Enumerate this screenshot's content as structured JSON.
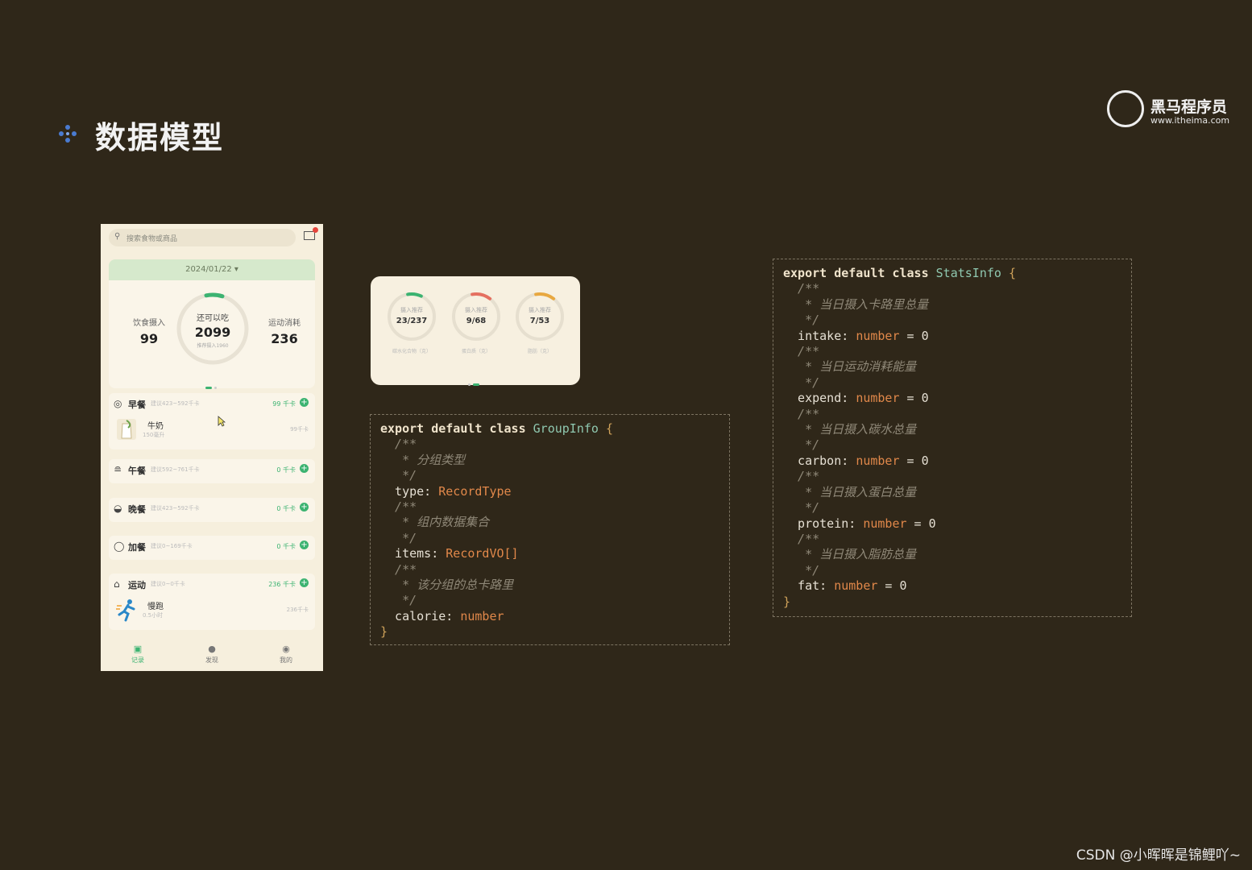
{
  "slide": {
    "title": "数据模型",
    "logo_text": "黑马程序员",
    "logo_url": "www.itheima.com",
    "watermark": "CSDN @小晖晖是锦鲤吖~"
  },
  "phone": {
    "search_placeholder": "搜索食物或商品",
    "date": "2024/01/22 ▾",
    "summary": {
      "intake_label": "饮食摄入",
      "intake_value": "99",
      "remain_label": "还可以吃",
      "remain_value": "2099",
      "recommend_label": "推荐摄入1960",
      "expend_label": "运动消耗",
      "expend_value": "236"
    },
    "meals": [
      {
        "name": "早餐",
        "suggest": "建议423~592千卡",
        "kcal": "99 千卡",
        "item_name": "牛奶",
        "item_amount": "150毫升",
        "item_kcal": "99千卡"
      },
      {
        "name": "午餐",
        "suggest": "建议592~761千卡",
        "kcal": "0 千卡"
      },
      {
        "name": "晚餐",
        "suggest": "建议423~592千卡",
        "kcal": "0 千卡"
      },
      {
        "name": "加餐",
        "suggest": "建议0~169千卡",
        "kcal": "0 千卡"
      },
      {
        "name": "运动",
        "suggest": "建议0~0千卡",
        "kcal": "236 千卡",
        "item_name": "慢跑",
        "item_amount": "0.5小时",
        "item_kcal": "236千卡"
      }
    ],
    "tabs": [
      {
        "label": "记录"
      },
      {
        "label": "发现"
      },
      {
        "label": "我的"
      }
    ]
  },
  "stats_card": {
    "rings": [
      {
        "label": "摄入推荐",
        "value": "23/237",
        "sub": "碳水化合物（克）",
        "progress": 0.097,
        "color": "#3cb371"
      },
      {
        "label": "摄入推荐",
        "value": "9/68",
        "sub": "蛋白质（克）",
        "progress": 0.132,
        "color": "#e57060"
      },
      {
        "label": "摄入推荐",
        "value": "7/53",
        "sub": "脂肪（克）",
        "progress": 0.132,
        "color": "#e8a840"
      }
    ]
  },
  "code_group": {
    "text": "export default class GroupInfo {\n  /**\n   * 分组类型\n   */\n  type: RecordType\n  /**\n   * 组内数据集合\n   */\n  items: RecordVO[]\n  /**\n   * 该分组的总卡路里\n   */\n  calorie: number\n}"
  },
  "code_stats": {
    "text": "export default class StatsInfo {\n  /**\n   * 当日摄入卡路里总量\n   */\n  intake: number = 0\n  /**\n   * 当日运动消耗能量\n   */\n  expend: number = 0\n  /**\n   * 当日摄入碳水总量\n   */\n  carbon: number = 0\n  /**\n   * 当日摄入蛋白总量\n   */\n  protein: number = 0\n  /**\n   * 当日摄入脂肪总量\n   */\n  fat: number = 0\n}"
  },
  "colors": {
    "background": "#2f2719",
    "accent_green": "#3cb371",
    "phone_bg": "#f6efdd"
  }
}
